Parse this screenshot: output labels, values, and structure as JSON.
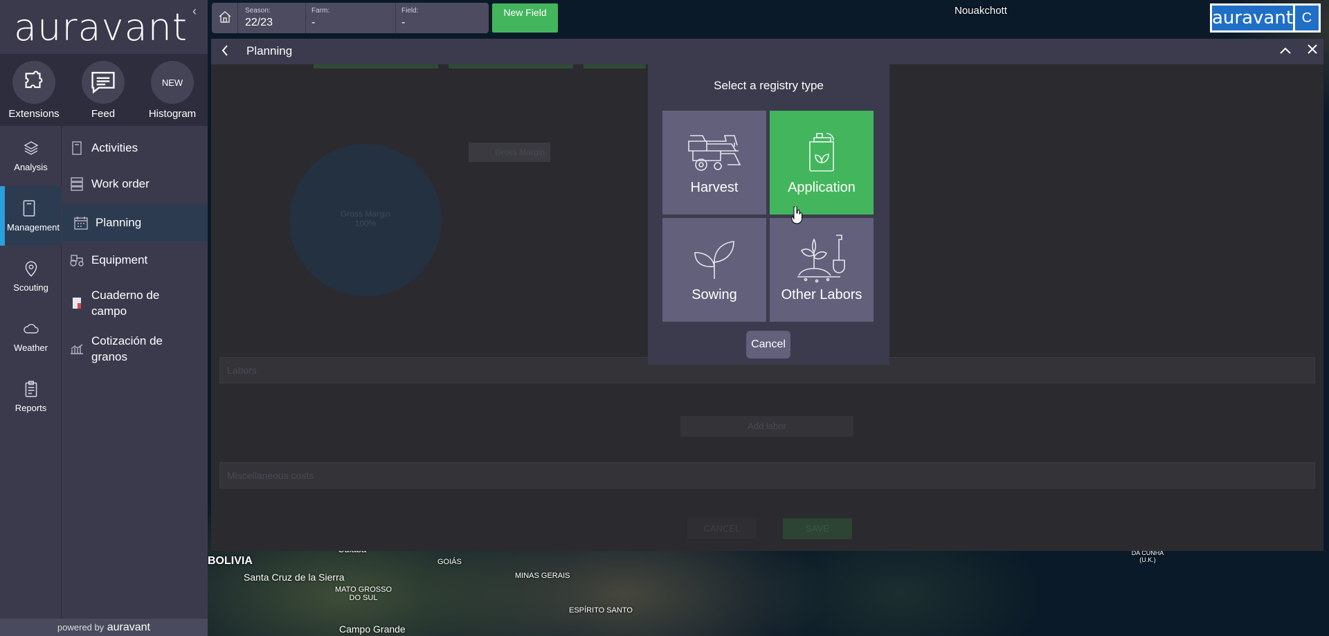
{
  "app": {
    "brand": "auravant",
    "powered_by_prefix": "powered by",
    "powered_by_brand": "auravant"
  },
  "quick_actions": [
    {
      "label": "Extensions",
      "icon": "puzzle-icon"
    },
    {
      "label": "Feed",
      "icon": "chat-icon"
    },
    {
      "label": "Histogram",
      "icon_text": "NEW"
    }
  ],
  "rail": [
    {
      "label": "Analysis",
      "icon": "layers-icon"
    },
    {
      "label": "Management",
      "icon": "notebook-icon",
      "active": true
    },
    {
      "label": "Scouting",
      "icon": "pin-icon"
    },
    {
      "label": "Weather",
      "icon": "cloud-icon"
    },
    {
      "label": "Reports",
      "icon": "clipboard-icon"
    }
  ],
  "submenu": [
    {
      "label": "Activities"
    },
    {
      "label": "Work order"
    },
    {
      "label": "Planning",
      "active": true
    },
    {
      "label": "Equipment"
    },
    {
      "label": "Cuaderno de campo"
    },
    {
      "label": "Cotización de granos"
    }
  ],
  "topbar": {
    "season_title": "Season:",
    "season_value": "22/23",
    "farm_title": "Farm:",
    "farm_value": "-",
    "field_title": "Field:",
    "field_value": "-",
    "new_field": "New Field"
  },
  "brand_right": {
    "logo": "auravant",
    "letter": "C"
  },
  "map_labels": {
    "nouakchott": "Nouakchott",
    "bolivia": "BOLIVIA",
    "santa_cruz": "Santa Cruz de la Sierra",
    "cuiaba": "Cuiabá",
    "goias": "GOIÁS",
    "mato_grosso": "MATO GROSSO DO SUL",
    "minas": "MINAS GERAIS",
    "espirito": "ESPÍRITO SANTO",
    "campo_grande": "Campo Grande",
    "da_cunha": "DA CUNHA (U.K.)"
  },
  "panel": {
    "title": "Planning",
    "bg_legend": "Gross Margin",
    "bg_pie_label": "Gross Margin",
    "bg_pie_value": "100%",
    "bg_labors": "Labors",
    "bg_add_labor": "Add labor",
    "bg_misc": "Miscellaneous costs",
    "bg_cancel": "CANCEL",
    "bg_save": "SAVE"
  },
  "modal": {
    "title": "Select a registry type",
    "options": [
      {
        "label": "Harvest",
        "icon": "harvester-icon"
      },
      {
        "label": "Application",
        "icon": "jerrycan-icon",
        "selected": true
      },
      {
        "label": "Sowing",
        "icon": "sprout-icon"
      },
      {
        "label": "Other Labors",
        "icon": "shovel-plant-icon"
      }
    ],
    "cancel": "Cancel"
  },
  "colors": {
    "accent_green": "#43b55d",
    "accent_blue": "#2aa0dd",
    "sidebar": "#3b3a4c",
    "tile": "#62607a"
  }
}
